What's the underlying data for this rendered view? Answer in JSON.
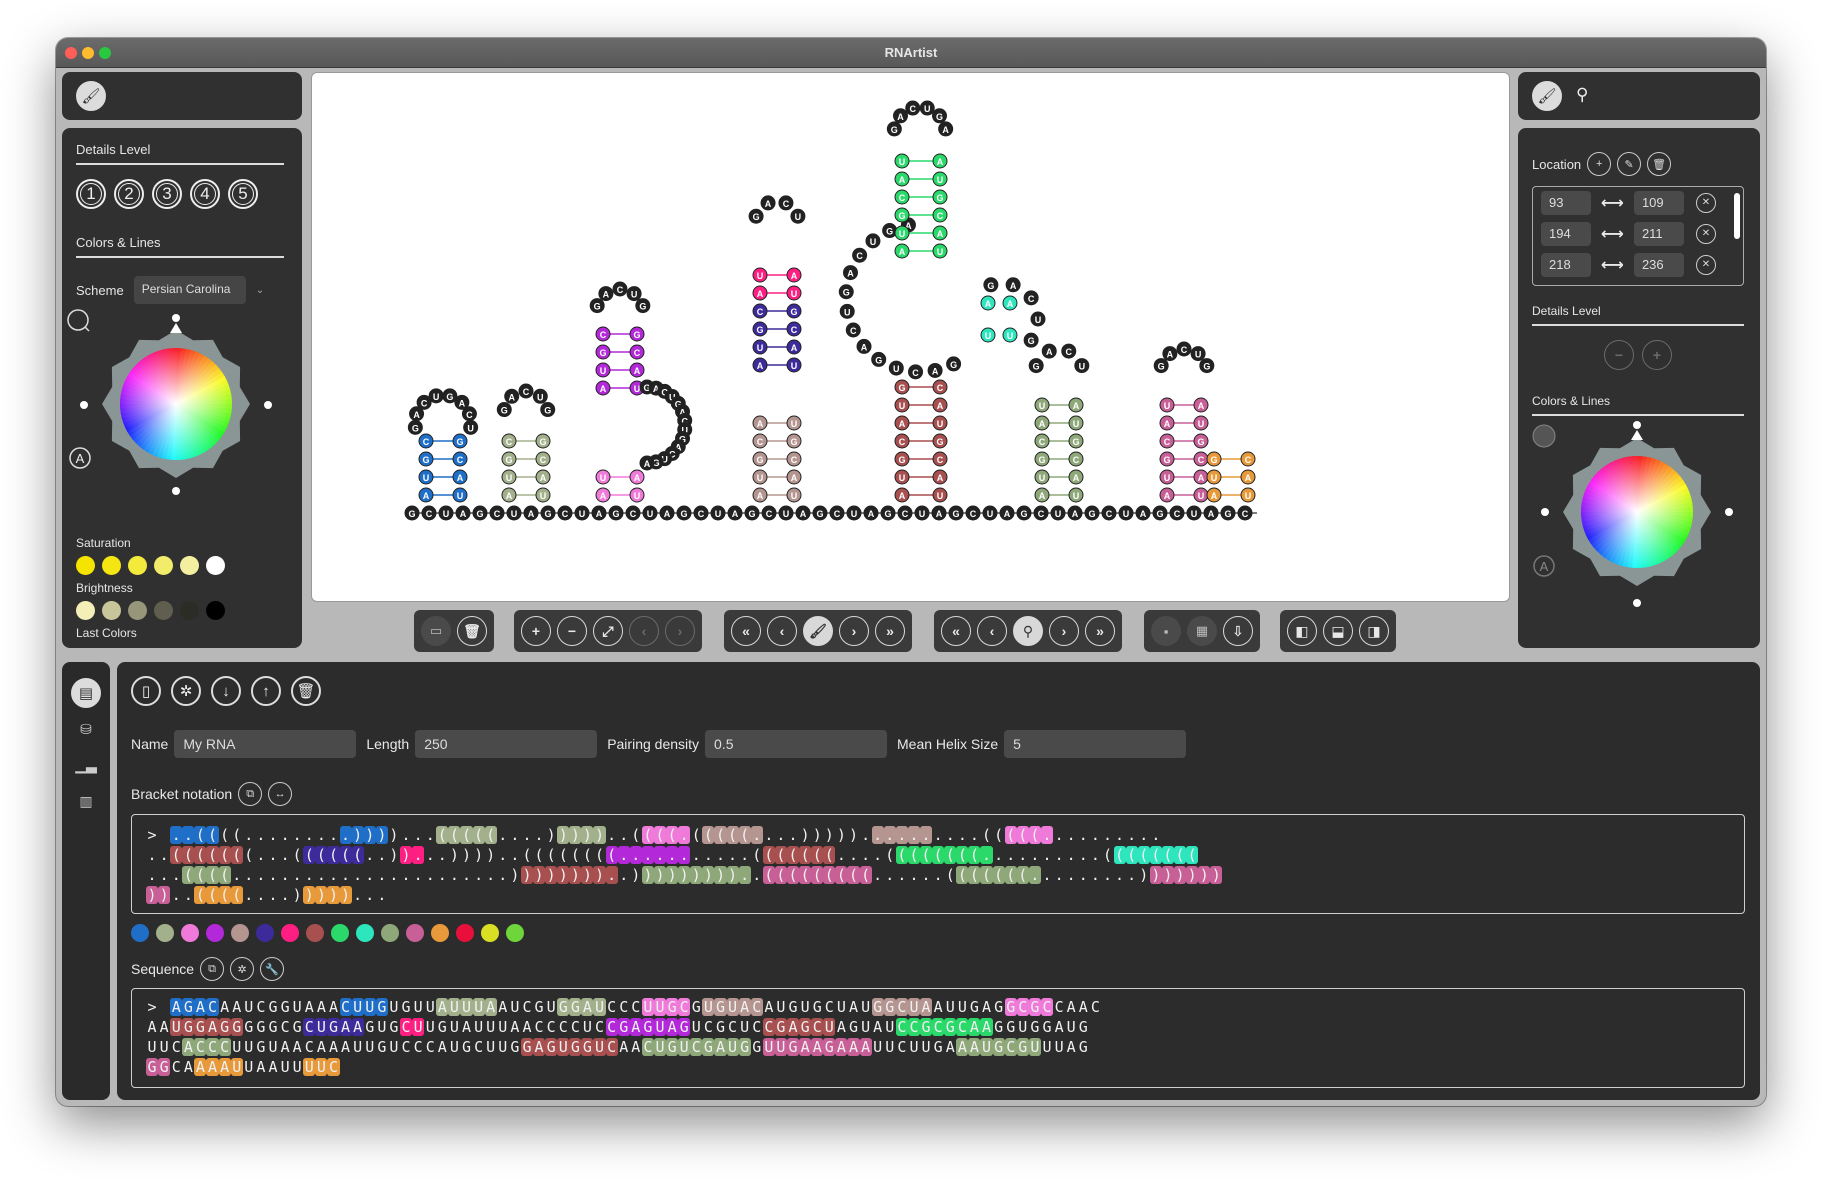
{
  "app": {
    "title": "RNArtist"
  },
  "left_panel": {
    "details_title": "Details Level",
    "levels": [
      "1",
      "2",
      "3",
      "4",
      "5"
    ],
    "colors_title": "Colors & Lines",
    "scheme_label": "Scheme",
    "scheme_value": "Persian Carolina",
    "saturation_label": "Saturation",
    "saturation_colors": [
      "#f5e400",
      "#f5e612",
      "#f3ea3c",
      "#f1ec6a",
      "#f2efa0",
      "#ffffff"
    ],
    "brightness_label": "Brightness",
    "brightness_colors": [
      "#f3efb6",
      "#c8c59a",
      "#97957a",
      "#5f5e4f",
      "#2c2c26",
      "#000000"
    ],
    "last_colors_label": "Last Colors",
    "wheel_letter": "A"
  },
  "right_panel": {
    "location_label": "Location",
    "locations": [
      {
        "from": "93",
        "to": "109"
      },
      {
        "from": "194",
        "to": "211"
      },
      {
        "from": "218",
        "to": "236"
      }
    ],
    "details_title": "Details Level",
    "colors_title": "Colors & Lines",
    "wheel_letter": "A"
  },
  "bottom": {
    "name_label": "Name",
    "name_value": "My RNA",
    "length_label": "Length",
    "length_value": "250",
    "density_label": "Pairing density",
    "density_value": "0.5",
    "helix_label": "Mean Helix Size",
    "helix_value": "5",
    "bracket_label": "Bracket notation",
    "sequence_label": "Sequence",
    "palette": [
      "#1f6fc9",
      "#a3b08c",
      "#f07ad9",
      "#b328d9",
      "#b59590",
      "#3d2b9b",
      "#ff1f82",
      "#a84f4f",
      "#2bd96b",
      "#2de6bd",
      "#8fa87a",
      "#c85f96",
      "#e89a3a",
      "#e8103a",
      "#d9e024",
      "#6ed63a"
    ],
    "bracket_rows": [
      "> ..((((.........))))...(((((....)))))..((((.(((((....)))))..........(((((..........",
      "..(((((((...((((((..))...))))..((((((((...........(((((((....((((((((..........((((((((",
      "...((((.......................))))))))..)))))))))..(((((((((......(((((((.........)))))))",
      "))..((((....)))))..."
    ],
    "sequence_rows": [
      "> AGACAAUCGGUAAACUUGUGUUAUUUAAUCGUGGAUCCCUUGCGUGUACAUGUGCUAUGGCUAAUUGAGGCGCCAAC",
      "AAUGGAGGGGGCGCUGAAGUGCUUGUAUUUAACCCCUCCGAGUAGUCGCUCCGAGCUAGUAUCCGCGCAAGGUGGAUG",
      "UUCACCCUUGUAACAAAUUGUCCCAUGCUUGGAGUGGUCAACUGUCGAUGGUUGAAGAAAUUCUUGAAAUGCGUUUAG",
      "GGCAAAAUUAAUUUUC"
    ]
  }
}
